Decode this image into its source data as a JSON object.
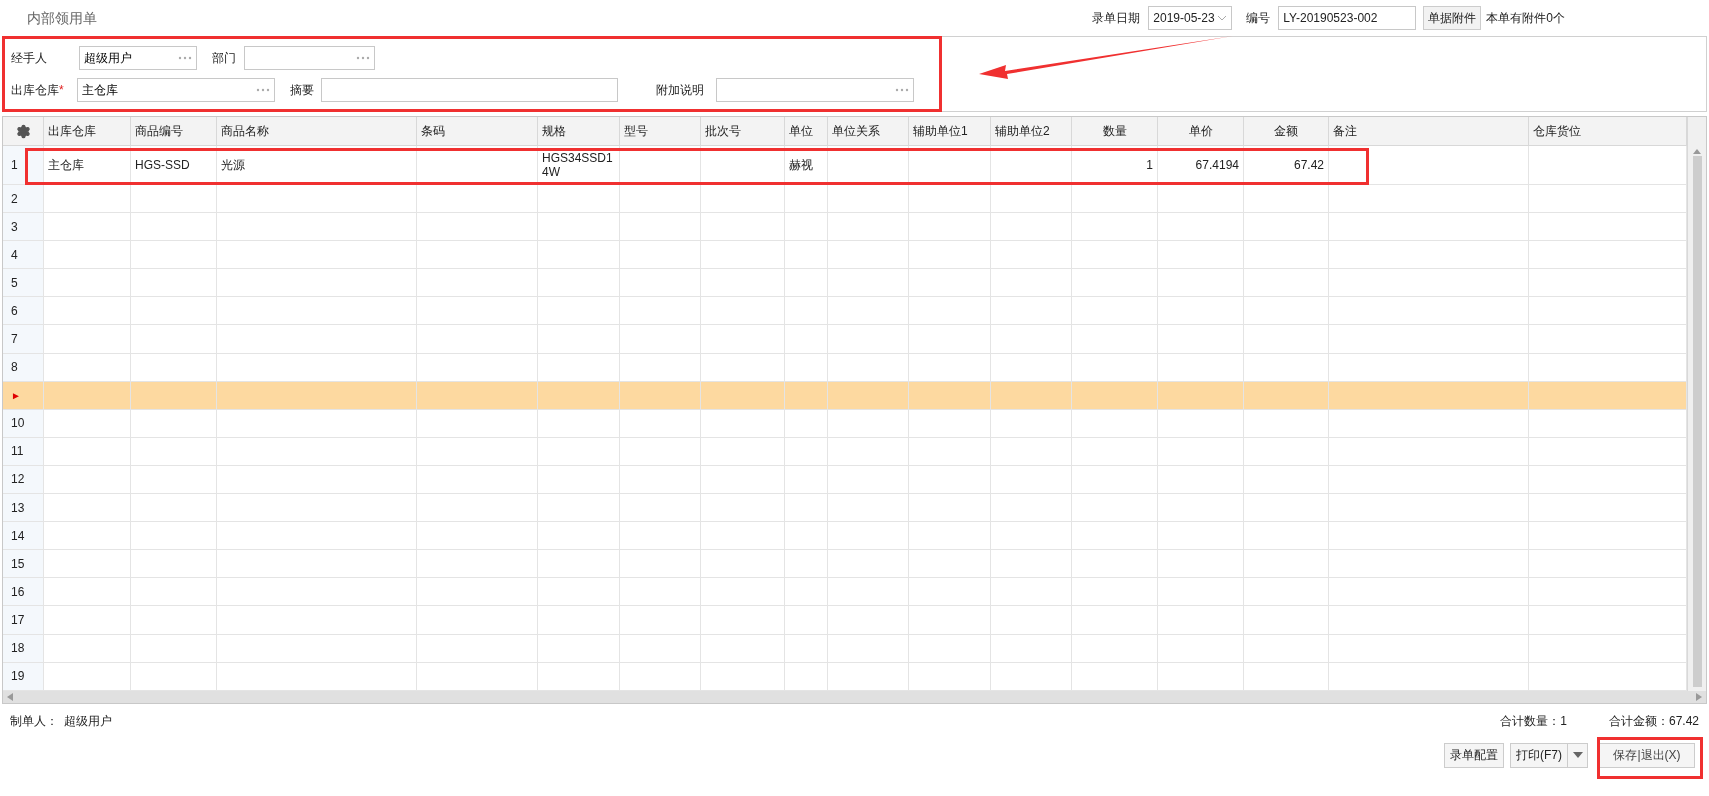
{
  "title": "内部领用单",
  "header": {
    "date_label": "录单日期",
    "date_value": "2019-05-23",
    "number_label": "编号",
    "number_value": "LY-20190523-002",
    "attach_button": "单据附件",
    "attach_note": "本单有附件0个"
  },
  "form": {
    "handler": {
      "label": "经手人",
      "value": "超级用户"
    },
    "department": {
      "label": "部门"
    },
    "warehouse": {
      "label": "出库仓库",
      "required_mark": "*",
      "value": "主仓库"
    },
    "summary": {
      "label": "摘要"
    },
    "note": {
      "label": "附加说明"
    }
  },
  "table": {
    "columns": [
      "出库仓库",
      "商品编号",
      "商品名称",
      "条码",
      "规格",
      "型号",
      "批次号",
      "单位",
      "单位关系",
      "辅助单位1",
      "辅助单位2",
      "数量",
      "单价",
      "金额",
      "备注",
      "仓库货位"
    ],
    "rows": [
      {
        "number": "1",
        "selected": false,
        "cells": [
          "主仓库",
          "HGS-SSD",
          "光源",
          null,
          "HGS34SSD14W",
          null,
          null,
          "赫视",
          null,
          null,
          null,
          "1",
          "67.4194",
          "67.42",
          null,
          null
        ]
      },
      {
        "number": "2",
        "selected": false
      },
      {
        "number": "3",
        "selected": false
      },
      {
        "number": "4",
        "selected": false
      },
      {
        "number": "5",
        "selected": false
      },
      {
        "number": "6",
        "selected": false
      },
      {
        "number": "7",
        "selected": false
      },
      {
        "number": "8",
        "selected": false
      },
      {
        "number": "►",
        "selected": true
      },
      {
        "number": "10",
        "selected": false
      },
      {
        "number": "11",
        "selected": false
      },
      {
        "number": "12",
        "selected": false
      },
      {
        "number": "13",
        "selected": false
      },
      {
        "number": "14",
        "selected": false
      },
      {
        "number": "15",
        "selected": false
      },
      {
        "number": "16",
        "selected": false
      },
      {
        "number": "17",
        "selected": false
      },
      {
        "number": "18",
        "selected": false
      },
      {
        "number": "19",
        "selected": false
      }
    ]
  },
  "footer": {
    "creator_label": "制单人：",
    "creator_value": "超级用户",
    "total_qty_label": "合计数量：",
    "total_qty_value": "1",
    "total_amount_label": "合计金额：",
    "total_amount_value": "67.42"
  },
  "buttons": {
    "config": "录单配置",
    "print": "打印(F7)",
    "save_exit": "保存|退出(X)"
  }
}
